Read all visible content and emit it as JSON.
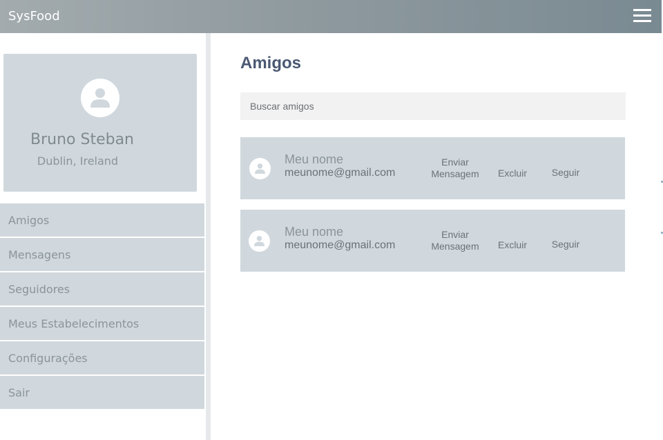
{
  "app": {
    "title": "SysFood"
  },
  "header": {
    "menu_icon": "hamburger-menu-icon"
  },
  "profile": {
    "avatar_icon": "user-avatar-icon",
    "name": "Bruno Steban",
    "location": "Dublin, Ireland"
  },
  "sidebar": {
    "items": [
      {
        "label": "Amigos"
      },
      {
        "label": "Mensagens"
      },
      {
        "label": "Seguidores"
      },
      {
        "label": "Meus Estabelecimentos"
      },
      {
        "label": "Configurações"
      },
      {
        "label": "Sair"
      }
    ]
  },
  "main": {
    "title": "Amigos",
    "search": {
      "placeholder": "Buscar amigos",
      "value": ""
    },
    "friends": [
      {
        "name": "Meu nome",
        "email": "meunome@gmail.com",
        "actions": {
          "message_line1": "Enviar",
          "message_line2": "Mensagem",
          "delete": "Excluir",
          "follow": "Seguir"
        }
      },
      {
        "name": "Meu nome",
        "email": "meunome@gmail.com",
        "actions": {
          "message_line1": "Enviar",
          "message_line2": "Mensagem",
          "delete": "Excluir",
          "follow": "Seguir"
        }
      }
    ]
  },
  "colors": {
    "card_bg": "#d0d8dd",
    "title": "#4a5872",
    "header_start": "#a3abae",
    "header_end": "#7a8a92"
  }
}
